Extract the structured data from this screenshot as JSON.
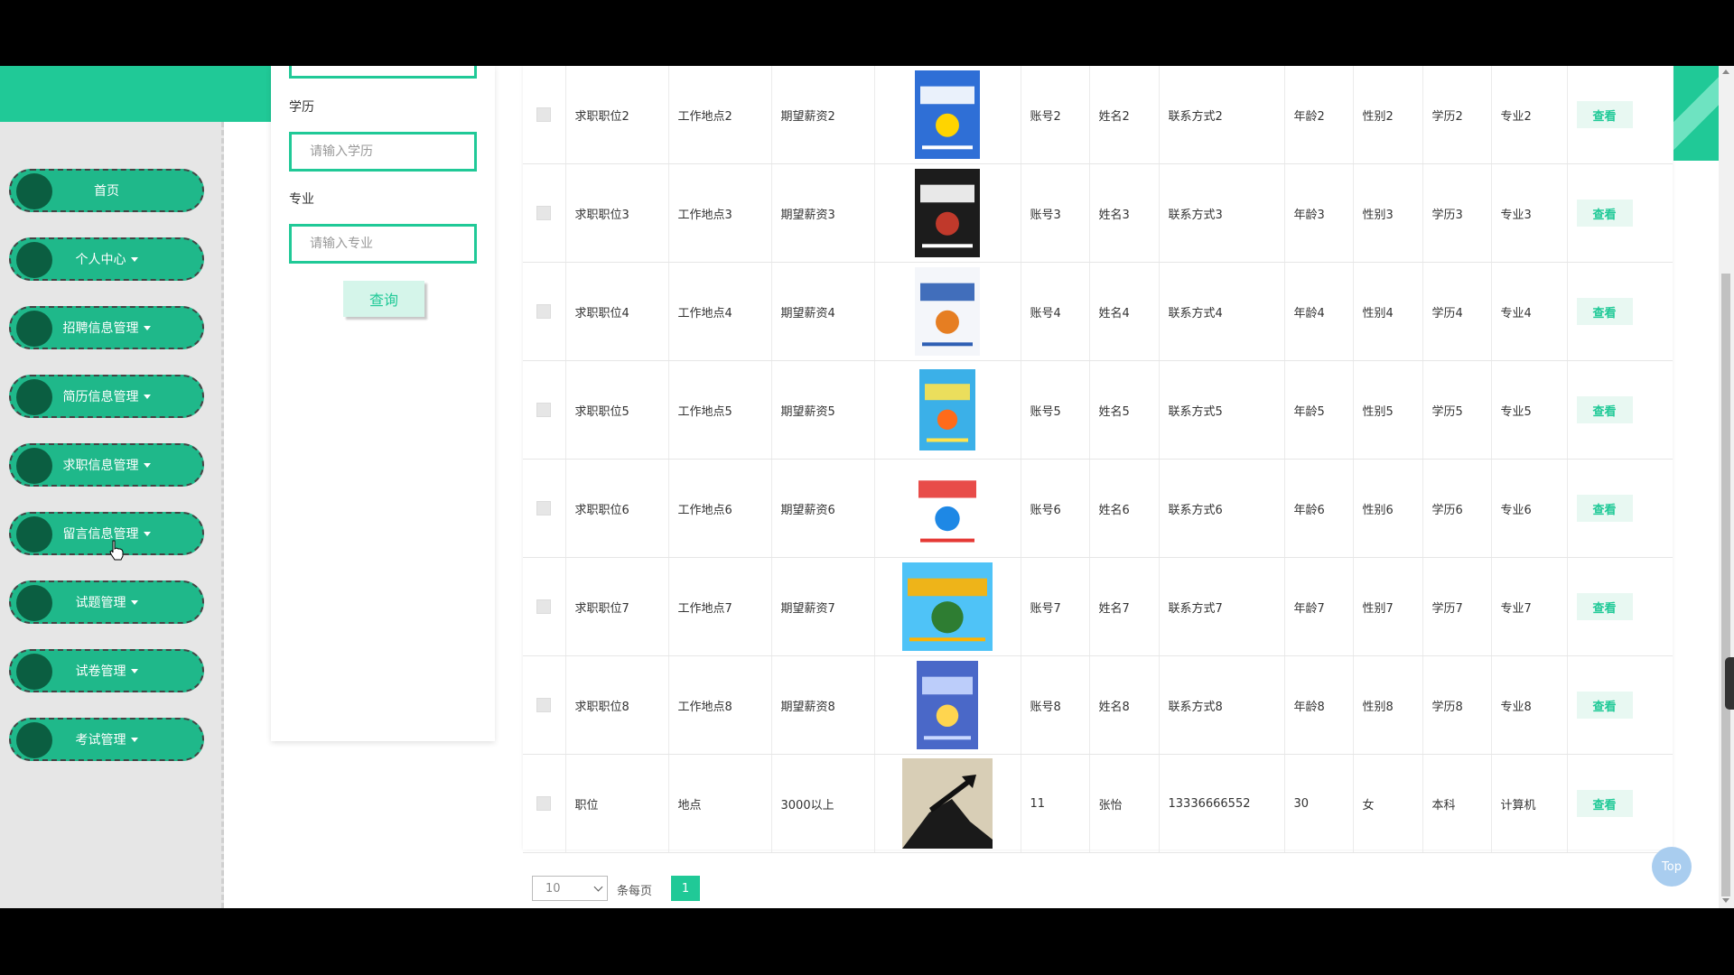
{
  "sidebar": {
    "items": [
      {
        "label": "首页",
        "has_caret": false
      },
      {
        "label": "个人中心",
        "has_caret": true
      },
      {
        "label": "招聘信息管理",
        "has_caret": true
      },
      {
        "label": "简历信息管理",
        "has_caret": true
      },
      {
        "label": "求职信息管理",
        "has_caret": true
      },
      {
        "label": "留言信息管理",
        "has_caret": true
      },
      {
        "label": "试题管理",
        "has_caret": true
      },
      {
        "label": "试卷管理",
        "has_caret": true
      },
      {
        "label": "考试管理",
        "has_caret": true
      }
    ]
  },
  "search": {
    "education_label": "学历",
    "education_placeholder": "请输入学历",
    "major_label": "专业",
    "major_placeholder": "请输入专业",
    "query_button": "查询"
  },
  "table": {
    "rows": [
      {
        "position": "求职职位2",
        "location": "工作地点2",
        "salary": "期望薪资2",
        "account": "账号2",
        "name": "姓名2",
        "contact": "联系方式2",
        "age": "年龄2",
        "gender": "性别2",
        "education": "学历2",
        "major": "专业2",
        "action": "查看",
        "image": "book-python-programming-cover"
      },
      {
        "position": "求职职位3",
        "location": "工作地点3",
        "salary": "期望薪资3",
        "account": "账号3",
        "name": "姓名3",
        "contact": "联系方式3",
        "age": "年龄3",
        "gender": "性别3",
        "education": "学历3",
        "major": "专业3",
        "action": "查看",
        "image": "book-python-games-cover"
      },
      {
        "position": "求职职位4",
        "location": "工作地点4",
        "salary": "期望薪资4",
        "account": "账号4",
        "name": "姓名4",
        "contact": "联系方式4",
        "age": "年龄4",
        "gender": "性别4",
        "education": "学历4",
        "major": "专业4",
        "action": "查看",
        "image": "book-pytorch-cover"
      },
      {
        "position": "求职职位5",
        "location": "工作地点5",
        "salary": "期望薪资5",
        "account": "账号5",
        "name": "姓名5",
        "contact": "联系方式5",
        "age": "年龄5",
        "gender": "性别5",
        "education": "学历5",
        "major": "专业5",
        "action": "查看",
        "image": "book-kids-programming-cover"
      },
      {
        "position": "求职职位6",
        "location": "工作地点6",
        "salary": "期望薪资6",
        "account": "账号6",
        "name": "姓名6",
        "contact": "联系方式6",
        "age": "年龄6",
        "gender": "性别6",
        "education": "学历6",
        "major": "专业6",
        "action": "查看",
        "image": "book-programming-course-cover"
      },
      {
        "position": "求职职位7",
        "location": "工作地点7",
        "salary": "期望薪资7",
        "account": "账号7",
        "name": "姓名7",
        "contact": "联系方式7",
        "age": "年龄7",
        "gender": "性别7",
        "education": "学历7",
        "major": "专业7",
        "action": "查看",
        "image": "book-scratch-cover"
      },
      {
        "position": "求职职位8",
        "location": "工作地点8",
        "salary": "期望薪资8",
        "account": "账号8",
        "name": "姓名8",
        "contact": "联系方式8",
        "age": "年龄8",
        "gender": "性别8",
        "education": "学历8",
        "major": "专业8",
        "action": "查看",
        "image": "book-python-blue-cover"
      },
      {
        "position": "职位",
        "location": "地点",
        "salary": "3000以上",
        "account": "11",
        "name": "张怡",
        "contact": "13336666552",
        "age": "30",
        "gender": "女",
        "education": "本科",
        "major": "计算机",
        "action": "查看",
        "image": "climber-arrow-photo"
      }
    ]
  },
  "pagination": {
    "page_size": "10",
    "per_page_label": "条每页",
    "current_page": "1"
  },
  "top_button": "Top",
  "colors": {
    "accent": "#20c997",
    "nav_button": "#1fb88a",
    "nav_dot": "#0b5e41",
    "view_button_bg": "#e8f8f2"
  }
}
